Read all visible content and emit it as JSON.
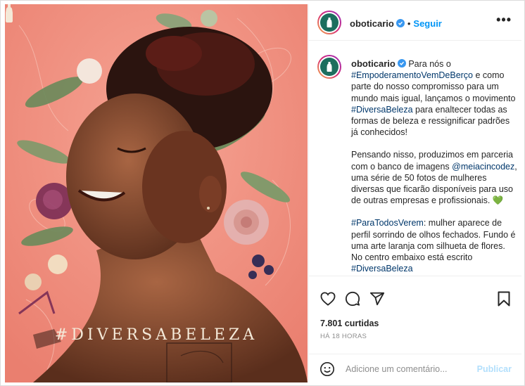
{
  "post": {
    "image_hashtag": "#DIVERSABELEZA",
    "image_alt": "Mulher sorrindo de olhos fechados sobre fundo laranja com flores"
  },
  "header": {
    "username": "oboticario",
    "separator": "•",
    "follow_label": "Seguir",
    "more_label": "•••"
  },
  "caption": {
    "username": "oboticario",
    "paragraph1": [
      {
        "text": " Para nós o ",
        "tag": false
      },
      {
        "text": "#EmpoderamentoVemDeBerço",
        "tag": true
      },
      {
        "text": " e como parte do nosso compromisso para um mundo mais igual, lançamos o movimento ",
        "tag": false
      },
      {
        "text": "#DiversaBeleza",
        "tag": true
      },
      {
        "text": " para enaltecer todas as formas de beleza e ressignificar padrões já conhecidos!",
        "tag": false
      }
    ],
    "paragraph2": [
      {
        "text": "Pensando nisso, produzimos em parceria com o banco de imagens ",
        "tag": false
      },
      {
        "text": "@meiacincodez",
        "tag": true
      },
      {
        "text": ", uma série de 50 fotos de mulheres diversas que ficarão disponíveis para uso de outras empresas e profissionais. 💚",
        "tag": false
      }
    ],
    "paragraph3": [
      {
        "text": "#ParaTodosVerem",
        "tag": true
      },
      {
        "text": ": mulher aparece de perfil sorrindo de olhos fechados. Fundo é uma arte laranja com silhueta de flores. No centro embaixo está escrito ",
        "tag": false
      },
      {
        "text": "#DiversaBeleza",
        "tag": true
      }
    ]
  },
  "stats": {
    "likes": "7.801 curtidas",
    "time_ago": "HÁ 18 HORAS"
  },
  "comment": {
    "placeholder": "Adicione um comentário...",
    "publish_label": "Publicar"
  },
  "colors": {
    "accent": "#0095f6",
    "background_image": "#f08e7e",
    "brand_green": "#1d6e5e"
  },
  "icons": [
    "heart-icon",
    "comment-icon",
    "share-icon",
    "bookmark-icon",
    "emoji-icon",
    "verified-icon",
    "more-icon"
  ]
}
